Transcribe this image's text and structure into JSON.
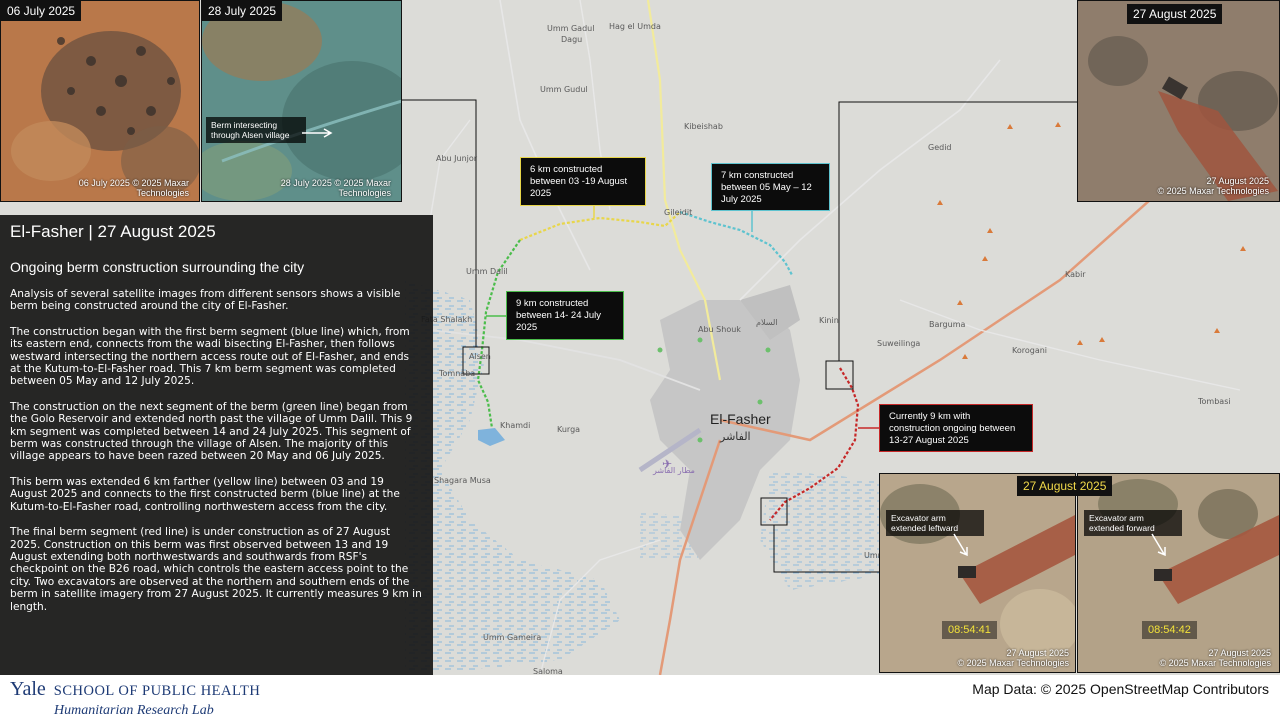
{
  "panel": {
    "title": "El-Fasher | 27 August 2025",
    "subtitle": "Ongoing berm construction surrounding the city",
    "paragraphs": [
      "Analysis of several satellite images from different sensors shows a visible berm being constructed around the city of El-Fasher.",
      "The construction began with the first berm segment (blue line) which, from its eastern end, connects from the wadi bisecting El-Fasher, then follows westward intersecting the northern access route out of El-Fasher, and ends at the Kutum-to-El-Fasher road. This 7 km berm segment was completed between 05 May and 12 July 2025.",
      "The construction on the next segment of the berm (green line) began from the Golo Reservoir and extended north past the village of Umm Dalil. This 9 km segment was completed between 14 and 24 July 2025. This segment of berm was constructed through the village of Alsen. The majority of this village appears to have been razed between 20 May and 06 July 2025.",
      "This berm was extended 6 km farther (yellow line) between 03 and 19 August 2025 and connects to the first constructed berm (blue line) at the Kutum-to-El-Fasher road, controlling northwestern access from the city.",
      "The final berm segment (red line) is under construction as of 27 August 2025. Construction on this berm was first observed between 13 and 19 August extending both northwestwards and southwards from RSF's checkpoint on the B26 road, which controls the eastern access point to the city. Two excavators are observed at the northern and southern ends of the berm in satellite imagery from 27 August 2025. It currently measures 9 km in length."
    ]
  },
  "callouts": {
    "yellow": "6 km constructed between 03 -19 August 2025",
    "cyan": "7 km constructed between 05 May – 12 July 2025",
    "green": "9 km constructed between 14- 24 July 2025",
    "red": "Currently 9 km with construction ongoing between 13-27 August 2025"
  },
  "insets": {
    "inset1": {
      "date": "06 July 2025",
      "credit_line1": "06 July 2025 © 2025 Maxar",
      "credit_line2": "Technologies"
    },
    "inset2": {
      "date": "28 July 2025",
      "credit_line1": "28 July 2025 © 2025 Maxar",
      "credit_line2": "Technologies",
      "annotation": "Berm intersecting through Alsen village"
    },
    "inset3": {
      "date": "27 August 2025",
      "credit_line1": "27 August 2025",
      "credit_line2": "© 2025 Maxar Technologies"
    },
    "excavator": {
      "date": "27 August 2025",
      "left": {
        "annotation": "Excavator arm extended leftward",
        "time": "08:54:41",
        "credit_line1": "27 August 2025",
        "credit_line2": "© 2025 Maxar Technologies"
      },
      "right": {
        "annotation": "Excavator arm extended forward",
        "time": "08:54:42",
        "credit_line1": "27 August 2025",
        "credit_line2": "© 2025 Maxar Technologies"
      }
    }
  },
  "places": [
    "Umm Gadul",
    "Dagu",
    "Hag el Umda",
    "Umm Gudul",
    "Kibeishab",
    "Gedid",
    "Abu Junjor",
    "Gileidit",
    "Umm Dalil",
    "Kabir",
    "Fata Shalakh",
    "Abu Shouk",
    "السلام",
    "Kinin",
    "Barguma",
    "Suweilinga",
    "Korogani",
    "Alsen",
    "Tomnaba",
    "Tombasi",
    "Khamdi",
    "Kurga",
    "Shagara Musa",
    "مطار الفاشر",
    "Umm Gameira",
    "Saloma",
    "Umm"
  ],
  "city": {
    "name": "El-Fasher",
    "name_ar": "الفاشر"
  },
  "footer": {
    "org_name": "Yale",
    "school": "SCHOOL OF PUBLIC HEALTH",
    "lab": "Humanitarian Research Lab",
    "map_data": "Map Data: © 2025 OpenStreetMap Contributors"
  },
  "colors": {
    "berm_blue": "#5ec3cf",
    "berm_green": "#4bbd4b",
    "berm_yellow": "#e8d64a",
    "berm_red": "#c62828",
    "road": "#e39a78",
    "water": "#a8c9e3"
  }
}
